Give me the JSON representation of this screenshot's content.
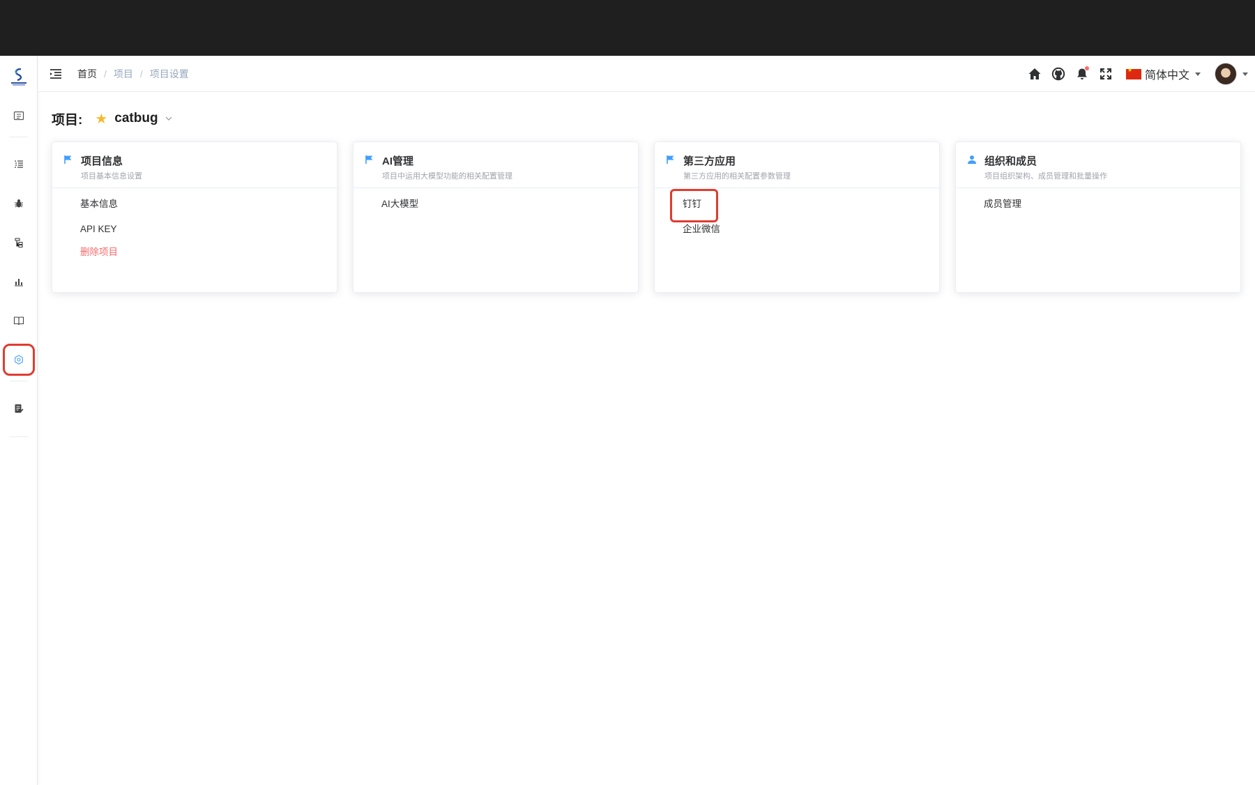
{
  "breadcrumb": {
    "items": [
      "首页",
      "项目",
      "项目设置"
    ]
  },
  "header": {
    "language": "简体中文"
  },
  "project": {
    "label": "项目:",
    "name": "catbug"
  },
  "cards": [
    {
      "title": "项目信息",
      "subtitle": "项目基本信息设置",
      "icon": "flag-icon",
      "links": [
        "基本信息",
        "API KEY",
        "删除项目"
      ]
    },
    {
      "title": "AI管理",
      "subtitle": "项目中运用大模型功能的相关配置管理",
      "icon": "flag-icon",
      "links": [
        "AI大模型"
      ]
    },
    {
      "title": "第三方应用",
      "subtitle": "第三方应用的相关配置参数管理",
      "icon": "flag-icon",
      "links": [
        "钉钉",
        "企业微信"
      ]
    },
    {
      "title": "组织和成员",
      "subtitle": "项目组织架构、成员管理和批量操作",
      "icon": "user-icon",
      "links": [
        "成员管理"
      ]
    }
  ],
  "sidebar": {
    "icons": [
      "project-list-icon",
      "test-case-list-icon",
      "bug-icon",
      "tree-icon",
      "chart-icon",
      "book-icon",
      "settings-icon",
      "report-icon"
    ],
    "active": "settings-icon"
  },
  "colors": {
    "accent": "#409eff",
    "danger": "#f56c6c",
    "highlight": "#e03c31",
    "star": "#f7ba2a"
  }
}
